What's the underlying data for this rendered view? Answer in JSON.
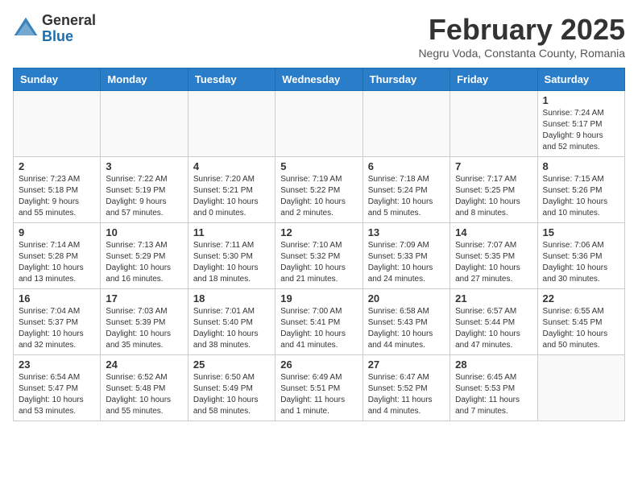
{
  "header": {
    "logo_general": "General",
    "logo_blue": "Blue",
    "month_year": "February 2025",
    "location": "Negru Voda, Constanta County, Romania"
  },
  "weekdays": [
    "Sunday",
    "Monday",
    "Tuesday",
    "Wednesday",
    "Thursday",
    "Friday",
    "Saturday"
  ],
  "weeks": [
    [
      {
        "day": "",
        "info": ""
      },
      {
        "day": "",
        "info": ""
      },
      {
        "day": "",
        "info": ""
      },
      {
        "day": "",
        "info": ""
      },
      {
        "day": "",
        "info": ""
      },
      {
        "day": "",
        "info": ""
      },
      {
        "day": "1",
        "info": "Sunrise: 7:24 AM\nSunset: 5:17 PM\nDaylight: 9 hours\nand 52 minutes."
      }
    ],
    [
      {
        "day": "2",
        "info": "Sunrise: 7:23 AM\nSunset: 5:18 PM\nDaylight: 9 hours\nand 55 minutes."
      },
      {
        "day": "3",
        "info": "Sunrise: 7:22 AM\nSunset: 5:19 PM\nDaylight: 9 hours\nand 57 minutes."
      },
      {
        "day": "4",
        "info": "Sunrise: 7:20 AM\nSunset: 5:21 PM\nDaylight: 10 hours\nand 0 minutes."
      },
      {
        "day": "5",
        "info": "Sunrise: 7:19 AM\nSunset: 5:22 PM\nDaylight: 10 hours\nand 2 minutes."
      },
      {
        "day": "6",
        "info": "Sunrise: 7:18 AM\nSunset: 5:24 PM\nDaylight: 10 hours\nand 5 minutes."
      },
      {
        "day": "7",
        "info": "Sunrise: 7:17 AM\nSunset: 5:25 PM\nDaylight: 10 hours\nand 8 minutes."
      },
      {
        "day": "8",
        "info": "Sunrise: 7:15 AM\nSunset: 5:26 PM\nDaylight: 10 hours\nand 10 minutes."
      }
    ],
    [
      {
        "day": "9",
        "info": "Sunrise: 7:14 AM\nSunset: 5:28 PM\nDaylight: 10 hours\nand 13 minutes."
      },
      {
        "day": "10",
        "info": "Sunrise: 7:13 AM\nSunset: 5:29 PM\nDaylight: 10 hours\nand 16 minutes."
      },
      {
        "day": "11",
        "info": "Sunrise: 7:11 AM\nSunset: 5:30 PM\nDaylight: 10 hours\nand 18 minutes."
      },
      {
        "day": "12",
        "info": "Sunrise: 7:10 AM\nSunset: 5:32 PM\nDaylight: 10 hours\nand 21 minutes."
      },
      {
        "day": "13",
        "info": "Sunrise: 7:09 AM\nSunset: 5:33 PM\nDaylight: 10 hours\nand 24 minutes."
      },
      {
        "day": "14",
        "info": "Sunrise: 7:07 AM\nSunset: 5:35 PM\nDaylight: 10 hours\nand 27 minutes."
      },
      {
        "day": "15",
        "info": "Sunrise: 7:06 AM\nSunset: 5:36 PM\nDaylight: 10 hours\nand 30 minutes."
      }
    ],
    [
      {
        "day": "16",
        "info": "Sunrise: 7:04 AM\nSunset: 5:37 PM\nDaylight: 10 hours\nand 32 minutes."
      },
      {
        "day": "17",
        "info": "Sunrise: 7:03 AM\nSunset: 5:39 PM\nDaylight: 10 hours\nand 35 minutes."
      },
      {
        "day": "18",
        "info": "Sunrise: 7:01 AM\nSunset: 5:40 PM\nDaylight: 10 hours\nand 38 minutes."
      },
      {
        "day": "19",
        "info": "Sunrise: 7:00 AM\nSunset: 5:41 PM\nDaylight: 10 hours\nand 41 minutes."
      },
      {
        "day": "20",
        "info": "Sunrise: 6:58 AM\nSunset: 5:43 PM\nDaylight: 10 hours\nand 44 minutes."
      },
      {
        "day": "21",
        "info": "Sunrise: 6:57 AM\nSunset: 5:44 PM\nDaylight: 10 hours\nand 47 minutes."
      },
      {
        "day": "22",
        "info": "Sunrise: 6:55 AM\nSunset: 5:45 PM\nDaylight: 10 hours\nand 50 minutes."
      }
    ],
    [
      {
        "day": "23",
        "info": "Sunrise: 6:54 AM\nSunset: 5:47 PM\nDaylight: 10 hours\nand 53 minutes."
      },
      {
        "day": "24",
        "info": "Sunrise: 6:52 AM\nSunset: 5:48 PM\nDaylight: 10 hours\nand 55 minutes."
      },
      {
        "day": "25",
        "info": "Sunrise: 6:50 AM\nSunset: 5:49 PM\nDaylight: 10 hours\nand 58 minutes."
      },
      {
        "day": "26",
        "info": "Sunrise: 6:49 AM\nSunset: 5:51 PM\nDaylight: 11 hours\nand 1 minute."
      },
      {
        "day": "27",
        "info": "Sunrise: 6:47 AM\nSunset: 5:52 PM\nDaylight: 11 hours\nand 4 minutes."
      },
      {
        "day": "28",
        "info": "Sunrise: 6:45 AM\nSunset: 5:53 PM\nDaylight: 11 hours\nand 7 minutes."
      },
      {
        "day": "",
        "info": ""
      }
    ]
  ]
}
